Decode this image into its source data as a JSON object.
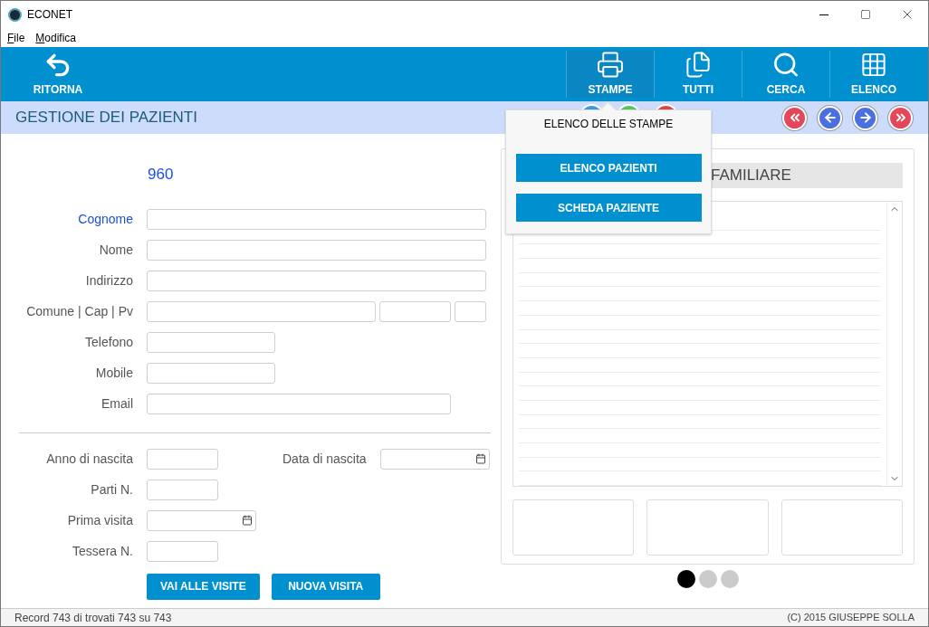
{
  "window": {
    "title": "ECONET"
  },
  "menu": [
    {
      "label": "File"
    },
    {
      "label": "Modifica"
    }
  ],
  "toolbar": {
    "back": {
      "label": "RITORNA"
    },
    "actions": [
      {
        "label": "STAMPE",
        "kind": "print",
        "selected": true
      },
      {
        "label": "TUTTI",
        "kind": "docs",
        "selected": false
      },
      {
        "label": "CERCA",
        "kind": "search",
        "selected": false
      },
      {
        "label": "ELENCO",
        "kind": "grid",
        "selected": false
      }
    ]
  },
  "header": {
    "title": "GESTIONE DEI PAZIENTI"
  },
  "nav_buttons": [
    {
      "kind": "first",
      "color": "#e5475a"
    },
    {
      "kind": "prev",
      "color": "#4a6fe0"
    },
    {
      "kind": "next",
      "color": "#4a6fe0"
    },
    {
      "kind": "last",
      "color": "#e5475a"
    }
  ],
  "record_actions": [
    {
      "color": "#3b9be0"
    },
    {
      "color": "#55c45a"
    },
    {
      "color": "#e04444"
    }
  ],
  "form": {
    "record_id": "960",
    "rows": [
      {
        "label": "Cognome",
        "active": true,
        "kind": "wide"
      },
      {
        "label": "Nome",
        "active": false,
        "kind": "wide"
      },
      {
        "label": "Indirizzo",
        "active": false,
        "kind": "wide"
      },
      {
        "label": "Comune | Cap | Pv",
        "active": false,
        "kind": "triple"
      },
      {
        "label": "Telefono",
        "active": false,
        "kind": "short"
      },
      {
        "label": "Mobile",
        "active": false,
        "kind": "short"
      },
      {
        "label": "Email",
        "active": false,
        "kind": "medium"
      }
    ],
    "lower_rows": [
      {
        "label": "Anno di nascita",
        "active": false,
        "kind": "year",
        "extra": {
          "label": "Data di nascita",
          "kind": "date"
        }
      },
      {
        "label": "Parti N.",
        "active": false,
        "kind": "year"
      },
      {
        "label": "Prima visita",
        "active": false,
        "kind": "date"
      },
      {
        "label": "Tessera N.",
        "active": false,
        "kind": "year"
      }
    ],
    "buttons": [
      "VAI ALLE VISITE",
      "NUOVA VISITA"
    ]
  },
  "panel": {
    "heading": "FAMILIARE",
    "pages": [
      {
        "selected": true
      },
      {
        "selected": false
      },
      {
        "selected": false
      }
    ]
  },
  "popup": {
    "title": "ELENCO DELLE STAMPE",
    "items": [
      "ELENCO PAZIENTI",
      "SCHEDA PAZIENTE"
    ]
  },
  "status_bar": {
    "left": "Record 743 di trovati 743 su 743",
    "right": "(C) 2015 GIUSEPPE SOLLA"
  }
}
